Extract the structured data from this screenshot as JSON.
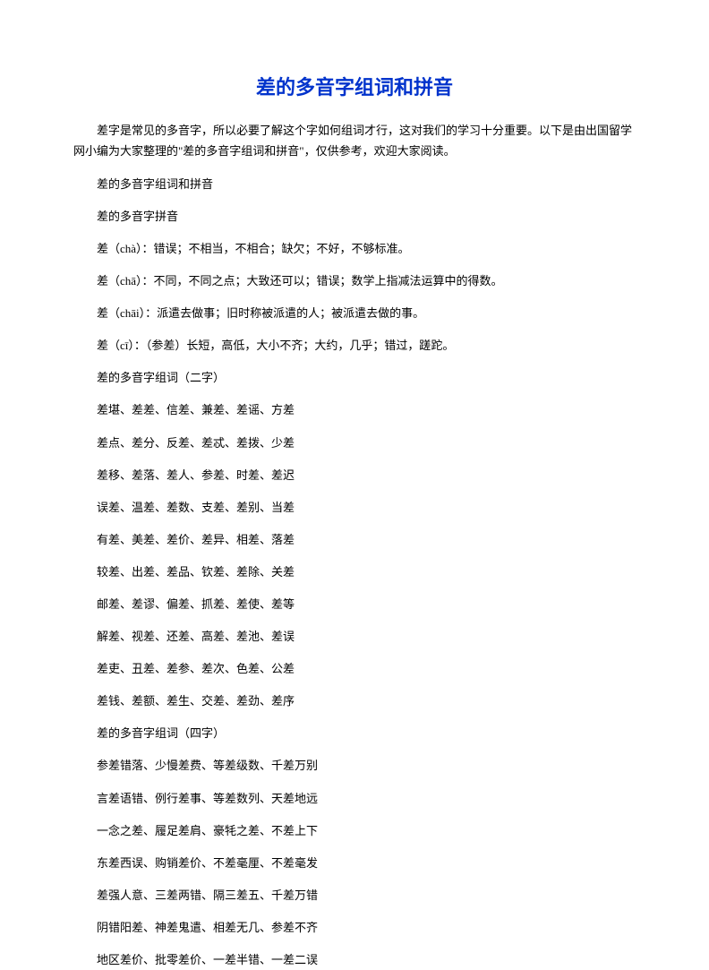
{
  "title": "差的多音字组词和拼音",
  "intro": "差字是常见的多音字，所以必要了解这个字如何组词才行，这对我们的学习十分重要。以下是由出国留学网小编为大家整理的\"差的多音字组词和拼音\"，仅供参考，欢迎大家阅读。",
  "paragraphs": [
    "差的多音字组词和拼音",
    "差的多音字拼音",
    "差（chà）：错误；不相当，不相合；缺欠；不好，不够标准。",
    "差（chā）：不同，不同之点；大致还可以；错误；数学上指减法运算中的得数。",
    "差（chāi）：派遣去做事；旧时称被派遣的人；被派遣去做的事。",
    "差（cī）：（参差）长短，高低，大小不齐；大约，几乎；错过，蹉跎。",
    "差的多音字组词（二字）",
    "差堪、差差、信差、兼差、差谣、方差",
    "差点、差分、反差、差忒、差拨、少差",
    "差移、差落、差人、参差、时差、差迟",
    "误差、温差、差数、支差、差别、当差",
    "有差、美差、差价、差异、相差、落差",
    "较差、出差、差品、钦差、差除、关差",
    "邮差、差谬、偏差、抓差、差使、差等",
    "解差、视差、还差、高差、差池、差误",
    "差吏、丑差、差参、差次、色差、公差",
    "差钱、差额、差生、交差、差劲、差序",
    "差的多音字组词（四字）",
    "参差错落、少慢差费、等差级数、千差万别",
    "言差语错、例行差事、等差数列、天差地远",
    "一念之差、履足差肩、豪牦之差、不差上下",
    "东差西误、购销差价、不差毫厘、不差毫发",
    "差强人意、三差两错、隔三差五、千差万错",
    "阴错阳差、神差鬼遣、相差无几、参差不齐",
    "地区差价、批零差价、一差半错、一差二误"
  ]
}
